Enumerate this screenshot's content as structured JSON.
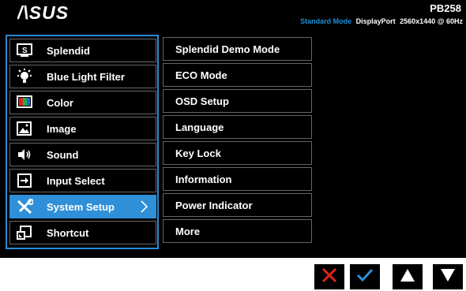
{
  "header": {
    "brand": "ASUS",
    "model": "PB258",
    "mode": "Standard Mode",
    "input": "DisplayPort",
    "resolution": "2560x1440 @ 60Hz"
  },
  "main_menu": [
    {
      "label": "Splendid",
      "icon": "splendid-icon"
    },
    {
      "label": "Blue Light Filter",
      "icon": "blue-light-icon"
    },
    {
      "label": "Color",
      "icon": "color-icon"
    },
    {
      "label": "Image",
      "icon": "image-icon"
    },
    {
      "label": "Sound",
      "icon": "sound-icon"
    },
    {
      "label": "Input Select",
      "icon": "input-select-icon"
    },
    {
      "label": "System Setup",
      "icon": "system-setup-icon",
      "selected": true
    },
    {
      "label": "Shortcut",
      "icon": "shortcut-icon"
    }
  ],
  "submenu": [
    {
      "label": "Splendid Demo Mode"
    },
    {
      "label": "ECO Mode"
    },
    {
      "label": "OSD Setup"
    },
    {
      "label": "Language"
    },
    {
      "label": "Key Lock"
    },
    {
      "label": "Information"
    },
    {
      "label": "Power Indicator"
    },
    {
      "label": "More"
    }
  ],
  "buttons": [
    {
      "name": "close",
      "icon": "close-icon"
    },
    {
      "name": "confirm",
      "icon": "checkmark-icon"
    },
    {
      "name": "up",
      "icon": "arrow-up-icon"
    },
    {
      "name": "down",
      "icon": "arrow-down-icon"
    }
  ],
  "colors": {
    "accent": "#2f8fd8",
    "close": "#e0251b",
    "mode_text": "#1e8fd6"
  }
}
